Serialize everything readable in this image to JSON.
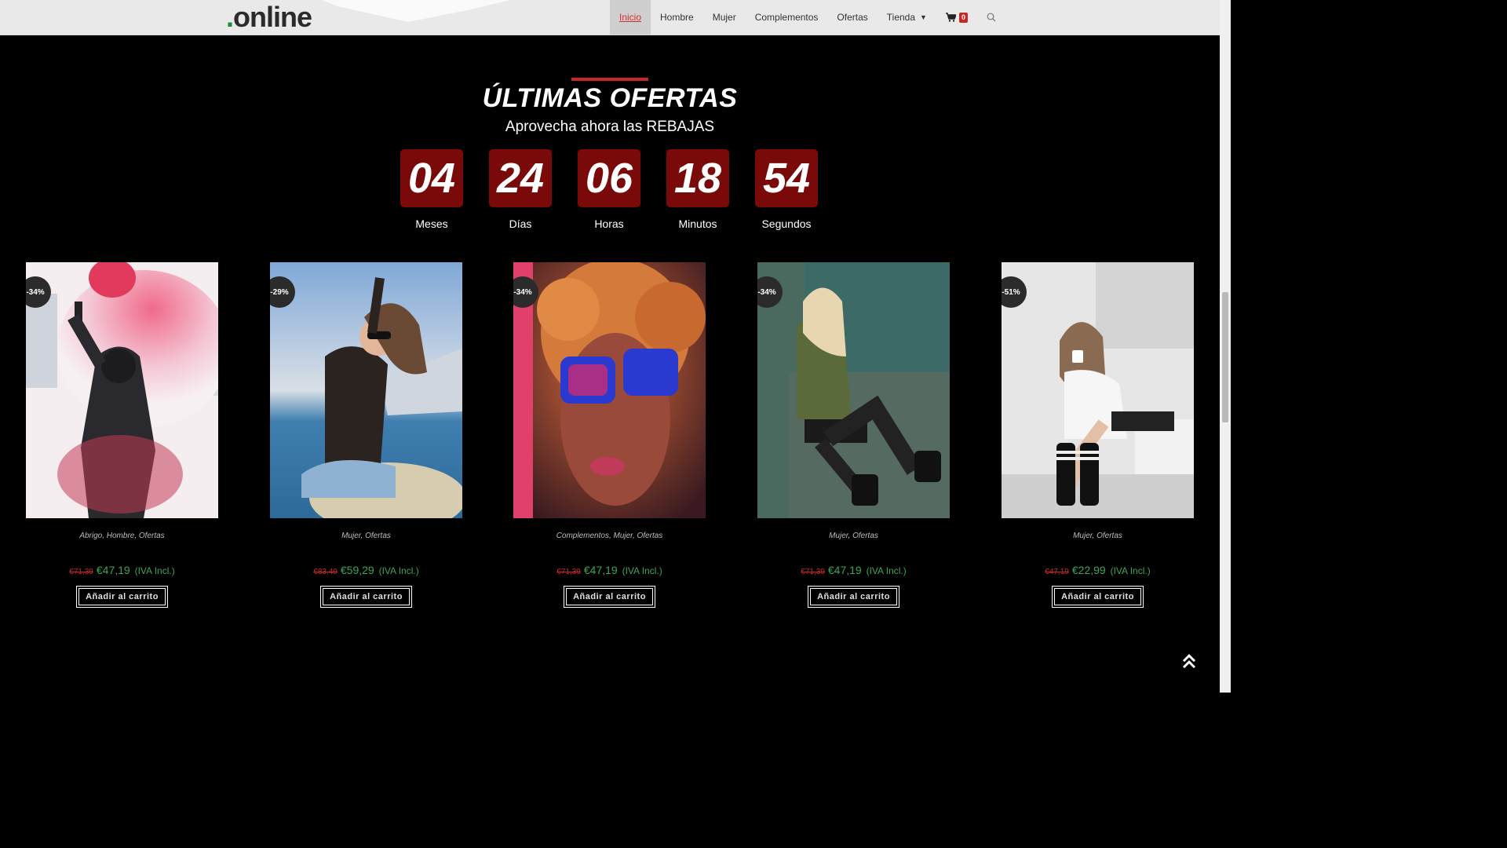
{
  "header": {
    "logo_dot": ".",
    "logo_text": "online",
    "nav": [
      {
        "label": "Inicio",
        "active": true
      },
      {
        "label": "Hombre"
      },
      {
        "label": "Mujer"
      },
      {
        "label": "Complementos"
      },
      {
        "label": "Ofertas"
      },
      {
        "label": "Tienda"
      }
    ],
    "cart_count": "0",
    "icons": {
      "dropdown": "chevron-down-icon",
      "cart": "cart-icon",
      "search": "search-icon"
    }
  },
  "section": {
    "title": "ÚLTIMAS OFERTAS",
    "subtitle": "Aprovecha ahora las REBAJAS"
  },
  "countdown": [
    {
      "value": "04",
      "label": "Meses"
    },
    {
      "value": "24",
      "label": "Días"
    },
    {
      "value": "06",
      "label": "Horas"
    },
    {
      "value": "18",
      "label": "Minutos"
    },
    {
      "value": "54",
      "label": "Segundos"
    }
  ],
  "products": [
    {
      "badge": "-34%",
      "categories": "Abrigo, Hombre, Ofertas",
      "old_price": "€71,39",
      "price": "€47,19",
      "tax": "(IVA Incl.)",
      "button": "Añadir al carrito",
      "image": "man-with-red-smoke-flare"
    },
    {
      "badge": "-29%",
      "categories": "Mujer, Ofertas",
      "old_price": "€83,49",
      "price": "€59,29",
      "tax": "(IVA Incl.)",
      "button": "Añadir al carrito",
      "image": "woman-leather-jacket-sunglasses"
    },
    {
      "badge": "-34%",
      "categories": "Complementos, Mujer, Ofertas",
      "old_price": "€71,39",
      "price": "€47,19",
      "tax": "(IVA Incl.)",
      "button": "Añadir al carrito",
      "image": "woman-reflective-sunglasses"
    },
    {
      "badge": "-34%",
      "categories": "Mujer, Ofertas",
      "old_price": "€71,39",
      "price": "€47,19",
      "tax": "(IVA Incl.)",
      "button": "Añadir al carrito",
      "image": "woman-fishnet-stockings"
    },
    {
      "badge": "-51%",
      "categories": "Mujer, Ofertas",
      "old_price": "€47,19",
      "price": "€22,99",
      "tax": "(IVA Incl.)",
      "button": "Añadir al carrito",
      "image": "woman-with-mug-in-kitchen"
    }
  ],
  "colors": {
    "accent": "#c62828",
    "countdown_bg": "#7a0a0a",
    "price_green": "#3aa655"
  },
  "scroll_to_top_icon": "double-chevron-up-icon"
}
